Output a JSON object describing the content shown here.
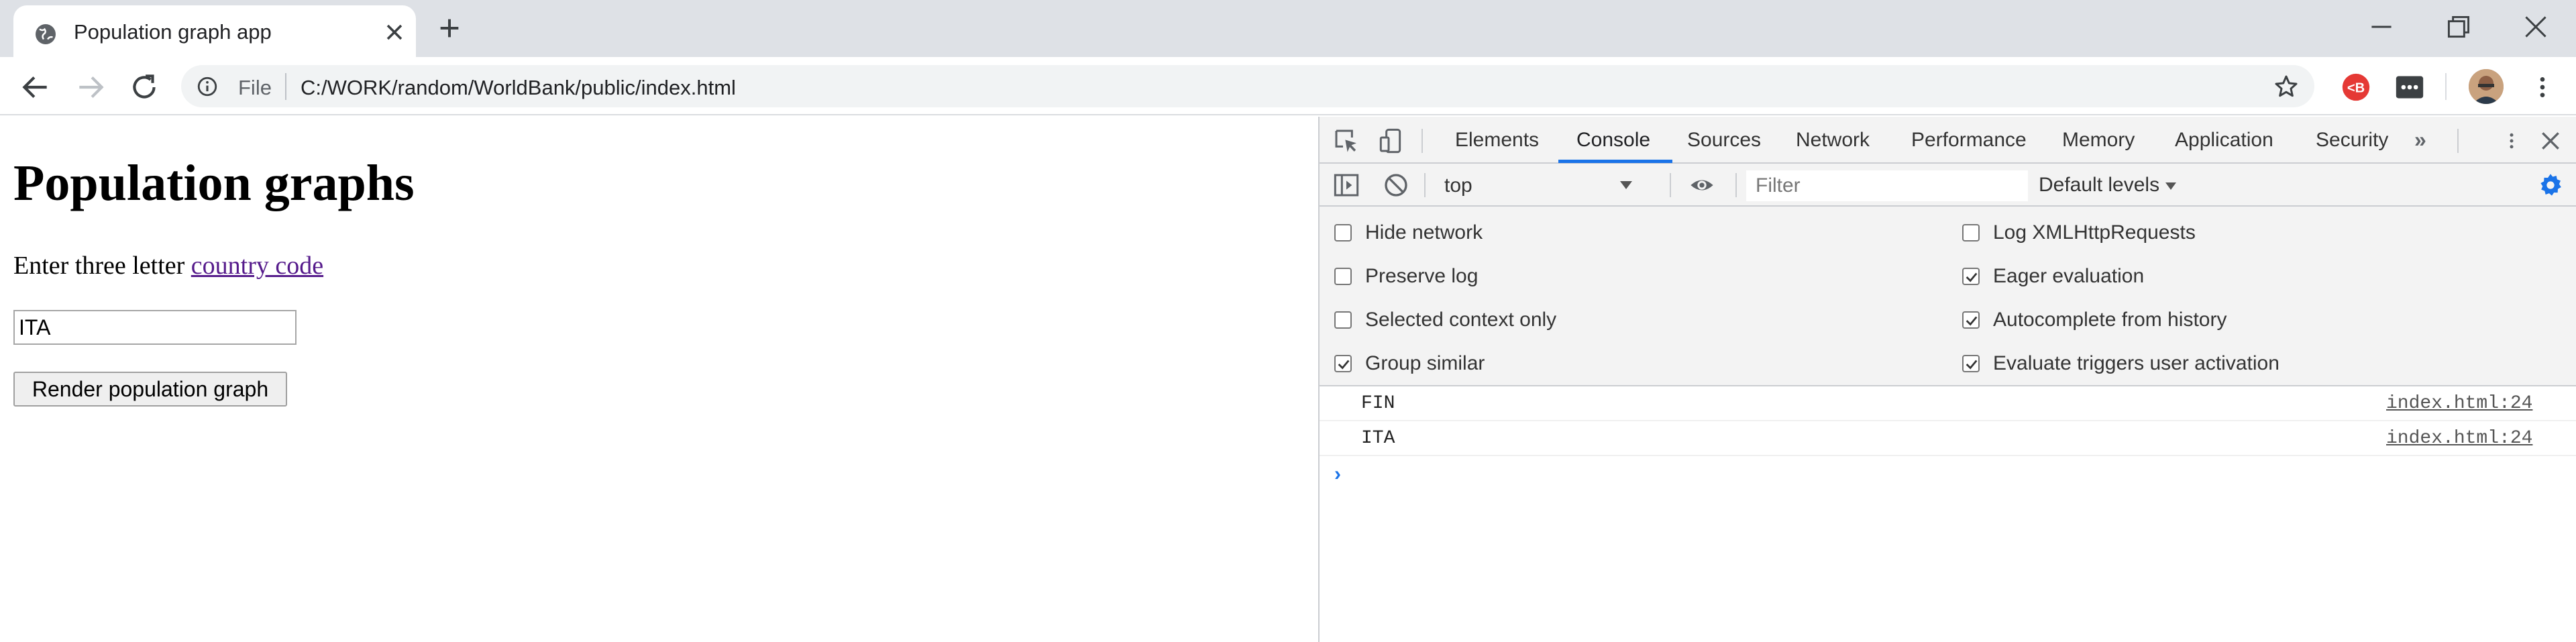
{
  "browser": {
    "tab_title": "Population graph app",
    "address_scheme": "File",
    "address_url": "C:/WORK/random/WorldBank/public/index.html",
    "accent_color": "#1a73e8"
  },
  "page": {
    "title": "Population graphs",
    "prompt_text": "Enter three letter ",
    "prompt_link": "country code",
    "input_value": "ITA",
    "button_label": "Render population graph"
  },
  "devtools": {
    "tabs": [
      "Elements",
      "Console",
      "Sources",
      "Network",
      "Performance",
      "Memory",
      "Application",
      "Security"
    ],
    "active_tab": "Console",
    "more_tabs_glyph": "»",
    "context": "top",
    "filter_placeholder": "Filter",
    "levels_label": "Default levels",
    "settings": {
      "left": [
        {
          "label": "Hide network",
          "checked": false
        },
        {
          "label": "Preserve log",
          "checked": false
        },
        {
          "label": "Selected context only",
          "checked": false
        },
        {
          "label": "Group similar",
          "checked": true
        }
      ],
      "right": [
        {
          "label": "Log XMLHttpRequests",
          "checked": false
        },
        {
          "label": "Eager evaluation",
          "checked": true
        },
        {
          "label": "Autocomplete from history",
          "checked": true
        },
        {
          "label": "Evaluate triggers user activation",
          "checked": true
        }
      ]
    },
    "logs": [
      {
        "message": "FIN",
        "source": "index.html:24"
      },
      {
        "message": "ITA",
        "source": "index.html:24"
      }
    ],
    "prompt_glyph": "›"
  }
}
